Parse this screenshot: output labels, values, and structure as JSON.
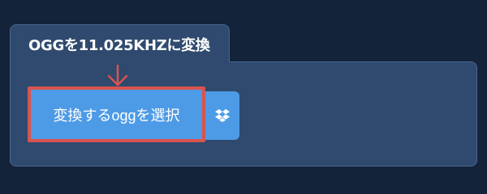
{
  "panel": {
    "title": "OGGを11.025KHZに変換"
  },
  "actions": {
    "select_label": "変換するoggを選択"
  },
  "icons": {
    "annotation": "down-arrow-icon",
    "dropbox": "dropbox-icon"
  },
  "colors": {
    "page_bg": "#13233a",
    "panel_bg": "#2f4a6e",
    "button_bg": "#4d9be6",
    "highlight_border": "#d9534f",
    "text": "#ffffff"
  }
}
